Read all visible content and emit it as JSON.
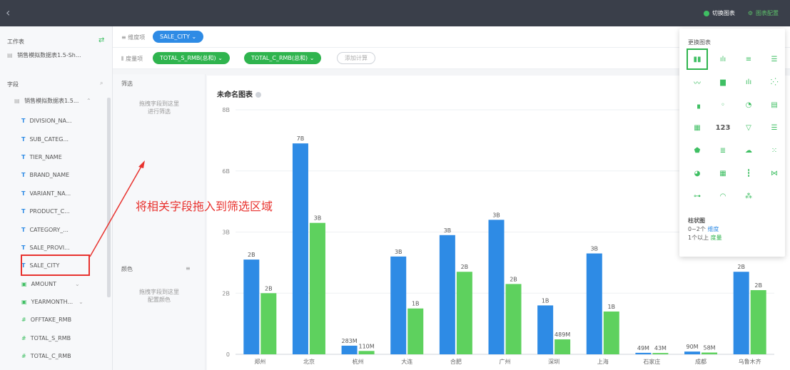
{
  "topbar": {
    "back_icon": "chevron-left-icon",
    "switch_chart_label": "切换图表",
    "chart_config_label": "图表配置"
  },
  "sidebar": {
    "worksheet_label": "工作表",
    "dataset_name": "销售模拟数据表1.5-Sh...",
    "fields_label": "字段",
    "dataset_short": "销售模拟数据表1.5...",
    "fields": [
      {
        "type": "T",
        "name": "DIVISION_NA..."
      },
      {
        "type": "T",
        "name": "SUB_CATEG..."
      },
      {
        "type": "T",
        "name": "TIER_NAME"
      },
      {
        "type": "T",
        "name": "BRAND_NAME"
      },
      {
        "type": "T",
        "name": "VARIANT_NA..."
      },
      {
        "type": "T",
        "name": "PRODUCT_C..."
      },
      {
        "type": "T",
        "name": "CATEGORY_..."
      },
      {
        "type": "T",
        "name": "SALE_PROVI..."
      },
      {
        "type": "T",
        "name": "SALE_CITY"
      },
      {
        "type": "date",
        "name": "AMOUNT"
      },
      {
        "type": "date",
        "name": "YEARMONTH..."
      },
      {
        "type": "#",
        "name": "OFFTAKE_RMB"
      },
      {
        "type": "#",
        "name": "TOTAL_S_RMB"
      },
      {
        "type": "#",
        "name": "TOTAL_C_RMB"
      }
    ]
  },
  "shelves": {
    "dimension_label": "维度项",
    "dimension_pill": "SALE_CITY",
    "measure_label": "度量项",
    "measure_pills": [
      "TOTAL_S_RMB(总和)",
      "TOTAL_C_RMB(总和)"
    ],
    "add_calc": "添加计算"
  },
  "filter_panel": {
    "title": "筛选",
    "hint_line1": "拖拽字段到这里",
    "hint_line2": "进行筛选",
    "color_title": "颜色",
    "color_hint_line1": "拖拽字段到这里",
    "color_hint_line2": "配置颜色"
  },
  "annotation": "将相关字段拖入到筛选区域",
  "popup": {
    "title": "更换图表",
    "selected_type": "柱状图",
    "rule_line1_prefix": "0~2个",
    "rule_line1_highlight": "维度",
    "rule_line2_prefix": "1个以上",
    "rule_line2_highlight": "度量",
    "icons": [
      "bar-chart-icon",
      "grouped-bar-icon",
      "horizontal-bar-icon",
      "stacked-horizontal-bar-icon",
      "line-chart-icon",
      "area-chart-icon",
      "combo-chart-icon",
      "scatter-icon",
      "map-icon",
      "bubble-map-icon",
      "pie-chart-icon",
      "table-icon",
      "heatmap-icon",
      "number-icon",
      "funnel-icon",
      "list-icon",
      "radar-icon",
      "filter-bar-icon",
      "word-cloud-icon",
      "dot-matrix-icon",
      "rose-chart-icon",
      "calendar-icon",
      "boxplot-icon",
      "sankey-icon",
      "tree-icon",
      "gauge-icon",
      "relation-icon"
    ]
  },
  "colors": {
    "series1": "#2e8be5",
    "series2": "#5ed15e",
    "accent": "#2fb44e",
    "annotation": "#e8322e"
  },
  "chart_data": {
    "type": "bar",
    "title": "未命名图表",
    "ylabel": "",
    "ylim": [
      0,
      8000000000
    ],
    "yticks": [
      "0",
      "2B",
      "3B",
      "6B",
      "8B"
    ],
    "categories": [
      "郑州",
      "北京",
      "杭州",
      "大连",
      "合肥",
      "广州",
      "深圳",
      "上海",
      "石家庄",
      "成都",
      "乌鲁木齐"
    ],
    "series": [
      {
        "values": [
          3100000000,
          6900000000,
          283000000,
          3200000000,
          3900000000,
          4400000000,
          1600000000,
          3300000000,
          49000000,
          90000000,
          2700000000
        ],
        "labels": [
          "2B",
          "7B",
          "283M",
          "3B",
          "3B",
          "3B",
          "1B",
          "3B",
          "49M",
          "90M",
          "2B"
        ]
      },
      {
        "values": [
          2000000000,
          4300000000,
          110000000,
          1500000000,
          2700000000,
          2300000000,
          489000000,
          1400000000,
          43000000,
          58000000,
          2100000000
        ],
        "labels": [
          "2B",
          "3B",
          "110M",
          "1B",
          "2B",
          "2B",
          "489M",
          "1B",
          "43M",
          "58M",
          "2B"
        ]
      }
    ]
  }
}
